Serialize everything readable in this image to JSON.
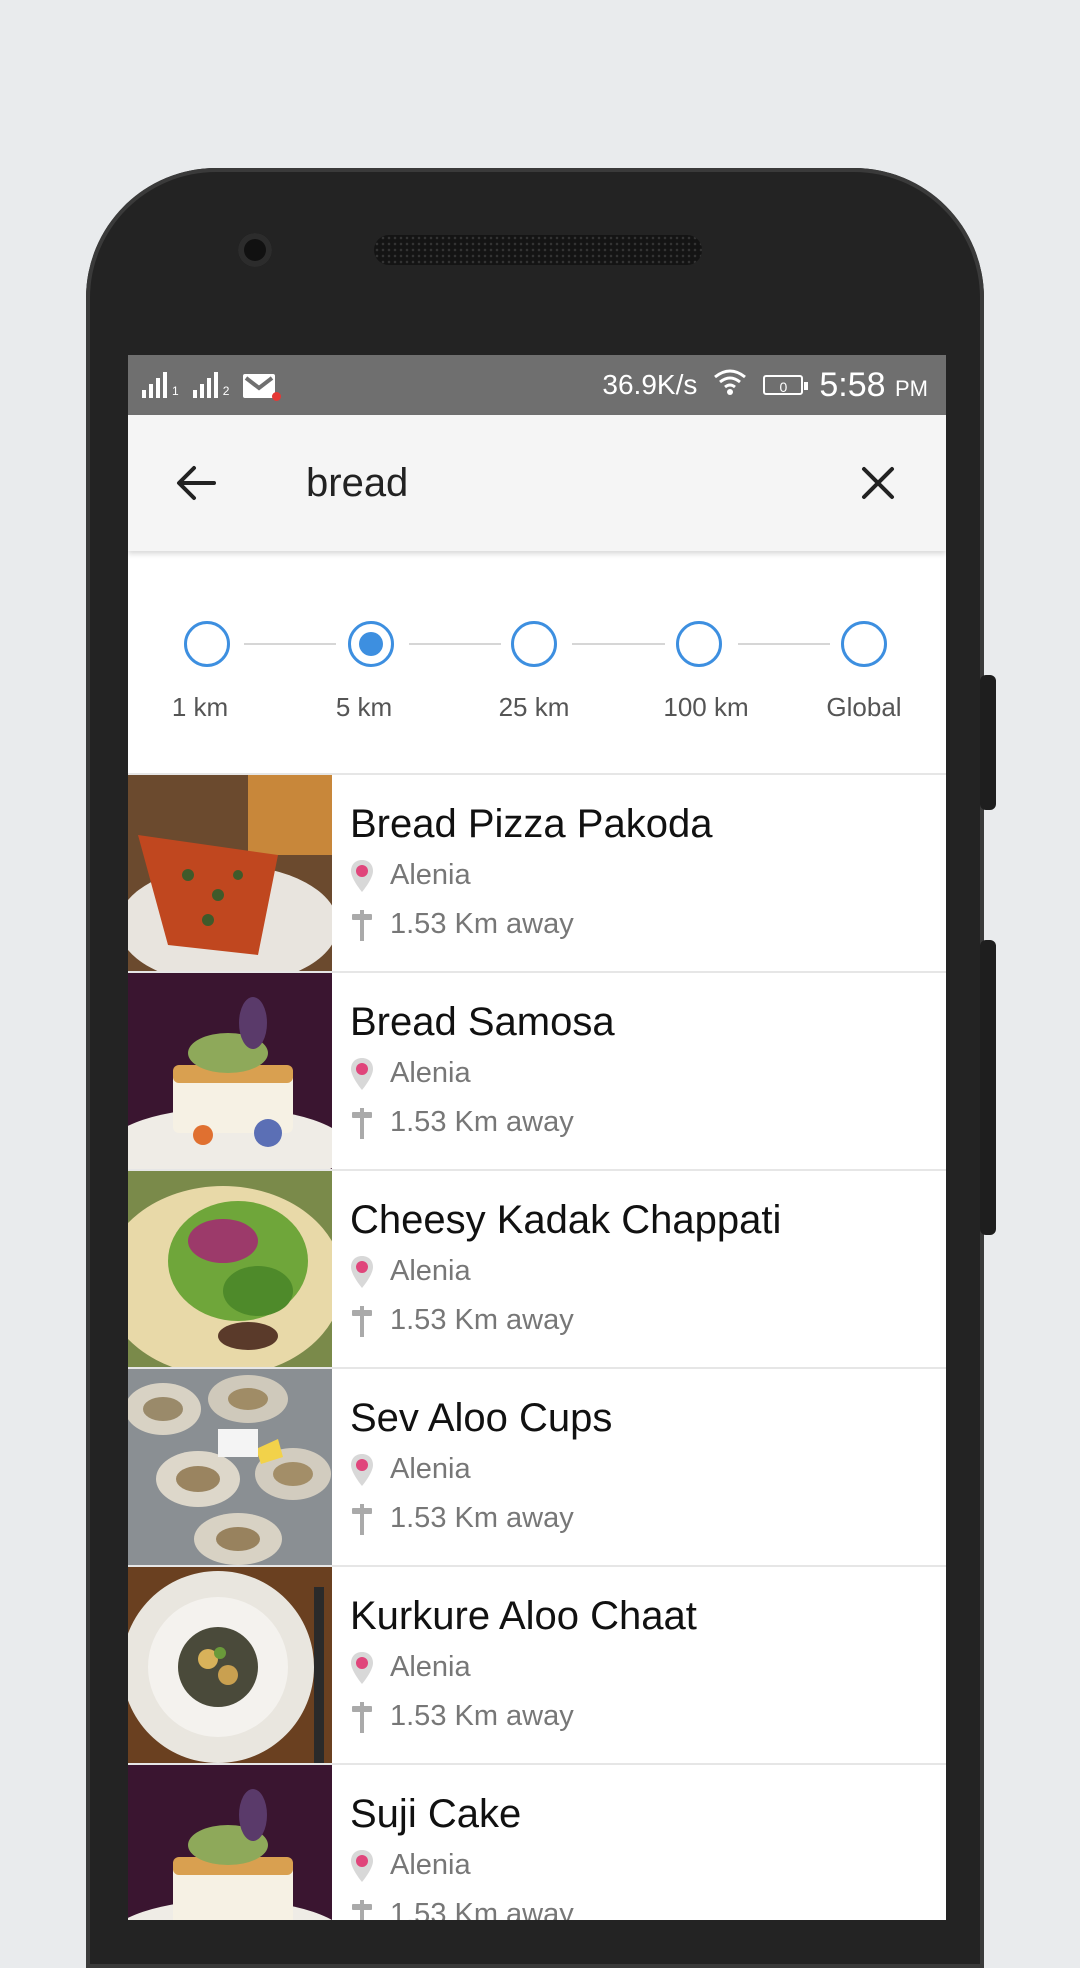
{
  "status_bar": {
    "sim1": "1",
    "sim2": "2",
    "speed": "36.9K/s",
    "battery": "0",
    "time": "5:58",
    "ampm": "PM"
  },
  "search": {
    "query": "bread",
    "back_icon": "arrow-left-icon",
    "close_icon": "close-icon"
  },
  "radius": {
    "options": [
      "1 km",
      "5 km",
      "25 km",
      "100 km",
      "Global"
    ],
    "selected": "5 km"
  },
  "results": [
    {
      "title": "Bread Pizza Pakoda",
      "place": "Alenia",
      "distance": "1.53 Km away"
    },
    {
      "title": "Bread Samosa",
      "place": "Alenia",
      "distance": "1.53 Km away"
    },
    {
      "title": "Cheesy Kadak Chappati",
      "place": "Alenia",
      "distance": "1.53 Km away"
    },
    {
      "title": "Sev Aloo Cups",
      "place": "Alenia",
      "distance": "1.53 Km away"
    },
    {
      "title": "Kurkure Aloo Chaat",
      "place": "Alenia",
      "distance": "1.53 Km away"
    },
    {
      "title": "Suji Cake",
      "place": "Alenia",
      "distance": "1.53 Km away"
    }
  ],
  "colors": {
    "accent": "#3d8fe0",
    "pin": "#e0457b"
  }
}
